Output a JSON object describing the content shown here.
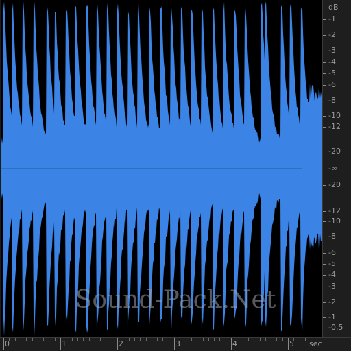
{
  "waveform": {
    "color": "#3b84e6",
    "background": "#000000",
    "peak_times_sec": [
      0.02,
      0.17,
      0.36,
      0.55,
      0.78,
      0.92,
      1.12,
      1.28,
      1.48,
      1.66,
      1.84,
      2.02,
      2.2,
      2.38,
      2.58,
      2.78,
      2.96,
      3.14,
      3.32,
      3.5,
      3.7,
      3.88,
      4.08,
      4.26,
      4.55,
      4.62,
      4.9,
      5.06,
      5.25
    ]
  },
  "db_scale": {
    "unit_label": "dB",
    "labels": [
      "-1",
      "-2",
      "-3",
      "-4",
      "-5",
      "-6",
      "-8",
      "-10",
      "-12",
      "-20",
      "-∞",
      "-20",
      "-12",
      "-10",
      "-8",
      "-6",
      "-5",
      "-4",
      "-3",
      "-2",
      "-1",
      "-0,5"
    ]
  },
  "time_scale": {
    "unit_label": "sec",
    "labels": [
      "0",
      "1",
      "2",
      "3",
      "4",
      "5"
    ]
  },
  "watermark": {
    "text": "Sound-Pack.Net"
  }
}
